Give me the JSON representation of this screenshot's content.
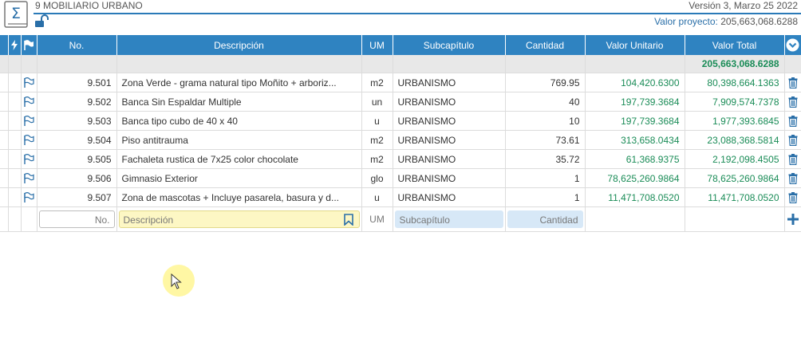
{
  "header": {
    "title": "9 MOBILIARIO URBANO",
    "version": "Versión 3, Marzo 25 2022",
    "valor_label": "Valor proyecto:",
    "valor_value": "205,663,068.6288"
  },
  "table": {
    "headers": [
      "No.",
      "Descripción",
      "UM",
      "Subcapítulo",
      "Cantidad",
      "Valor Unitario",
      "Valor Total"
    ],
    "total": "205,663,068.6288",
    "rows": [
      {
        "no": "9.501",
        "desc": "Zona Verde - grama natural tipo Moñito + arboriz...",
        "um": "m2",
        "sub": "URBANISMO",
        "cant": "769.95",
        "vu": "104,420.6300",
        "vt": "80,398,664.1363"
      },
      {
        "no": "9.502",
        "desc": "Banca Sin Espaldar Multiple",
        "um": "un",
        "sub": "URBANISMO",
        "cant": "40",
        "vu": "197,739.3684",
        "vt": "7,909,574.7378"
      },
      {
        "no": "9.503",
        "desc": "Banca tipo cubo de 40 x 40",
        "um": "u",
        "sub": "URBANISMO",
        "cant": "10",
        "vu": "197,739.3684",
        "vt": "1,977,393.6845"
      },
      {
        "no": "9.504",
        "desc": "Piso antitrauma",
        "um": "m2",
        "sub": "URBANISMO",
        "cant": "73.61",
        "vu": "313,658.0434",
        "vt": "23,088,368.5814"
      },
      {
        "no": "9.505",
        "desc": "Fachaleta rustica de 7x25 color chocolate",
        "um": "m2",
        "sub": "URBANISMO",
        "cant": "35.72",
        "vu": "61,368.9375",
        "vt": "2,192,098.4505"
      },
      {
        "no": "9.506",
        "desc": "Gimnasio Exterior",
        "um": "glo",
        "sub": "URBANISMO",
        "cant": "1",
        "vu": "78,625,260.9864",
        "vt": "78,625,260.9864"
      },
      {
        "no": "9.507",
        "desc": "Zona de mascotas + Incluye pasarela, basura y d...",
        "um": "u",
        "sub": "URBANISMO",
        "cant": "1",
        "vu": "11,471,708.0520",
        "vt": "11,471,708.0520"
      }
    ],
    "new_row": {
      "no_placeholder": "No.",
      "desc_placeholder": "Descripción",
      "um_placeholder": "UM",
      "sub_placeholder": "Subcapítulo",
      "cant_placeholder": "Cantidad"
    }
  },
  "icons": {
    "logo": "sigma-book-icon",
    "lock": "unlock-icon",
    "bolt": "lightning-icon",
    "flag": "flag-icon",
    "trash": "trash-icon",
    "chevron": "chevron-down-circle-icon",
    "bookmark": "bookmark-icon",
    "add": "plus-icon"
  },
  "colors": {
    "accent": "#2f83c1",
    "green": "#1a8c57",
    "yellow_input": "#fdf7c4",
    "blue_input": "#d7e8f7"
  }
}
